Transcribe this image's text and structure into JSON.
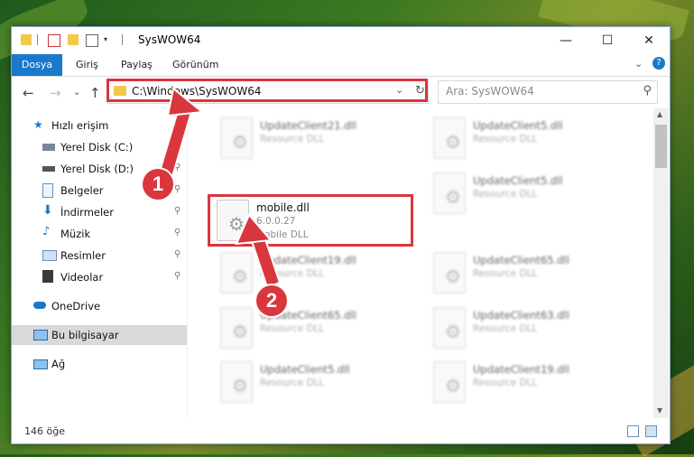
{
  "window": {
    "title": "SysWOW64",
    "minimize_glyph": "—",
    "maximize_glyph": "☐",
    "close_glyph": "✕"
  },
  "ribbon": {
    "tabs": [
      "Dosya",
      "Giriş",
      "Paylaş",
      "Görünüm"
    ],
    "expand_glyph": "⌄",
    "help_glyph": "?"
  },
  "address": {
    "path": "C:\\Windows\\SysWOW64",
    "dropdown_glyph": "⌄",
    "refresh_glyph": "↻",
    "search_placeholder": "Ara: SysWOW64",
    "search_glyph": "⚲"
  },
  "nav": {
    "back_glyph": "←",
    "forward_glyph": "→",
    "recent_glyph": "⌄",
    "up_glyph": "↑",
    "items": [
      {
        "label": "Hızlı erişim",
        "icon": "star-icon",
        "top": true
      },
      {
        "label": "Yerel Disk (C:)",
        "icon": "drive-icon",
        "pinned": true
      },
      {
        "label": "Yerel Disk (D:)",
        "icon": "drive-icon",
        "pinned": true
      },
      {
        "label": "Belgeler",
        "icon": "documents-icon",
        "pinned": true
      },
      {
        "label": "İndirmeler",
        "icon": "download-icon",
        "pinned": true
      },
      {
        "label": "Müzik",
        "icon": "music-icon",
        "pinned": true
      },
      {
        "label": "Resimler",
        "icon": "pictures-icon",
        "pinned": true
      },
      {
        "label": "Videolar",
        "icon": "video-icon",
        "pinned": true
      },
      {
        "label": "OneDrive",
        "icon": "onedrive-icon",
        "top": true
      },
      {
        "label": "Bu bilgisayar",
        "icon": "computer-icon",
        "top": true,
        "selected": true
      },
      {
        "label": "Ağ",
        "icon": "network-icon",
        "top": true
      }
    ],
    "pin_glyph": "📌"
  },
  "files": {
    "left": [
      {
        "name": "UpdateClient21.dll",
        "type": "Resource DLL"
      },
      {
        "name": "mobile.dll",
        "version": "6.0.0.27",
        "type": "Mobile DLL"
      },
      {
        "name": "UpdateClient19.dll",
        "type": "Resource DLL"
      },
      {
        "name": "UpdateClient65.dll",
        "type": "Resource DLL"
      },
      {
        "name": "UpdateClient5.dll",
        "type": "Resource DLL"
      }
    ],
    "right": [
      {
        "name": "UpdateClient5.dll",
        "type": "Resource DLL"
      },
      {
        "name": "UpdateClient5.dll",
        "type": "Resource DLL"
      },
      {
        "name": "UpdateClient65.dll",
        "type": "Resource DLL"
      },
      {
        "name": "UpdateClient63.dll",
        "type": "Resource DLL"
      },
      {
        "name": "UpdateClient19.dll",
        "type": "Resource DLL"
      }
    ]
  },
  "status": {
    "item_count": "146 öğe"
  },
  "callouts": [
    "1",
    "2"
  ],
  "colors": {
    "accent": "#1979ca",
    "highlight": "#d9363e",
    "folder": "#f4c84a"
  }
}
